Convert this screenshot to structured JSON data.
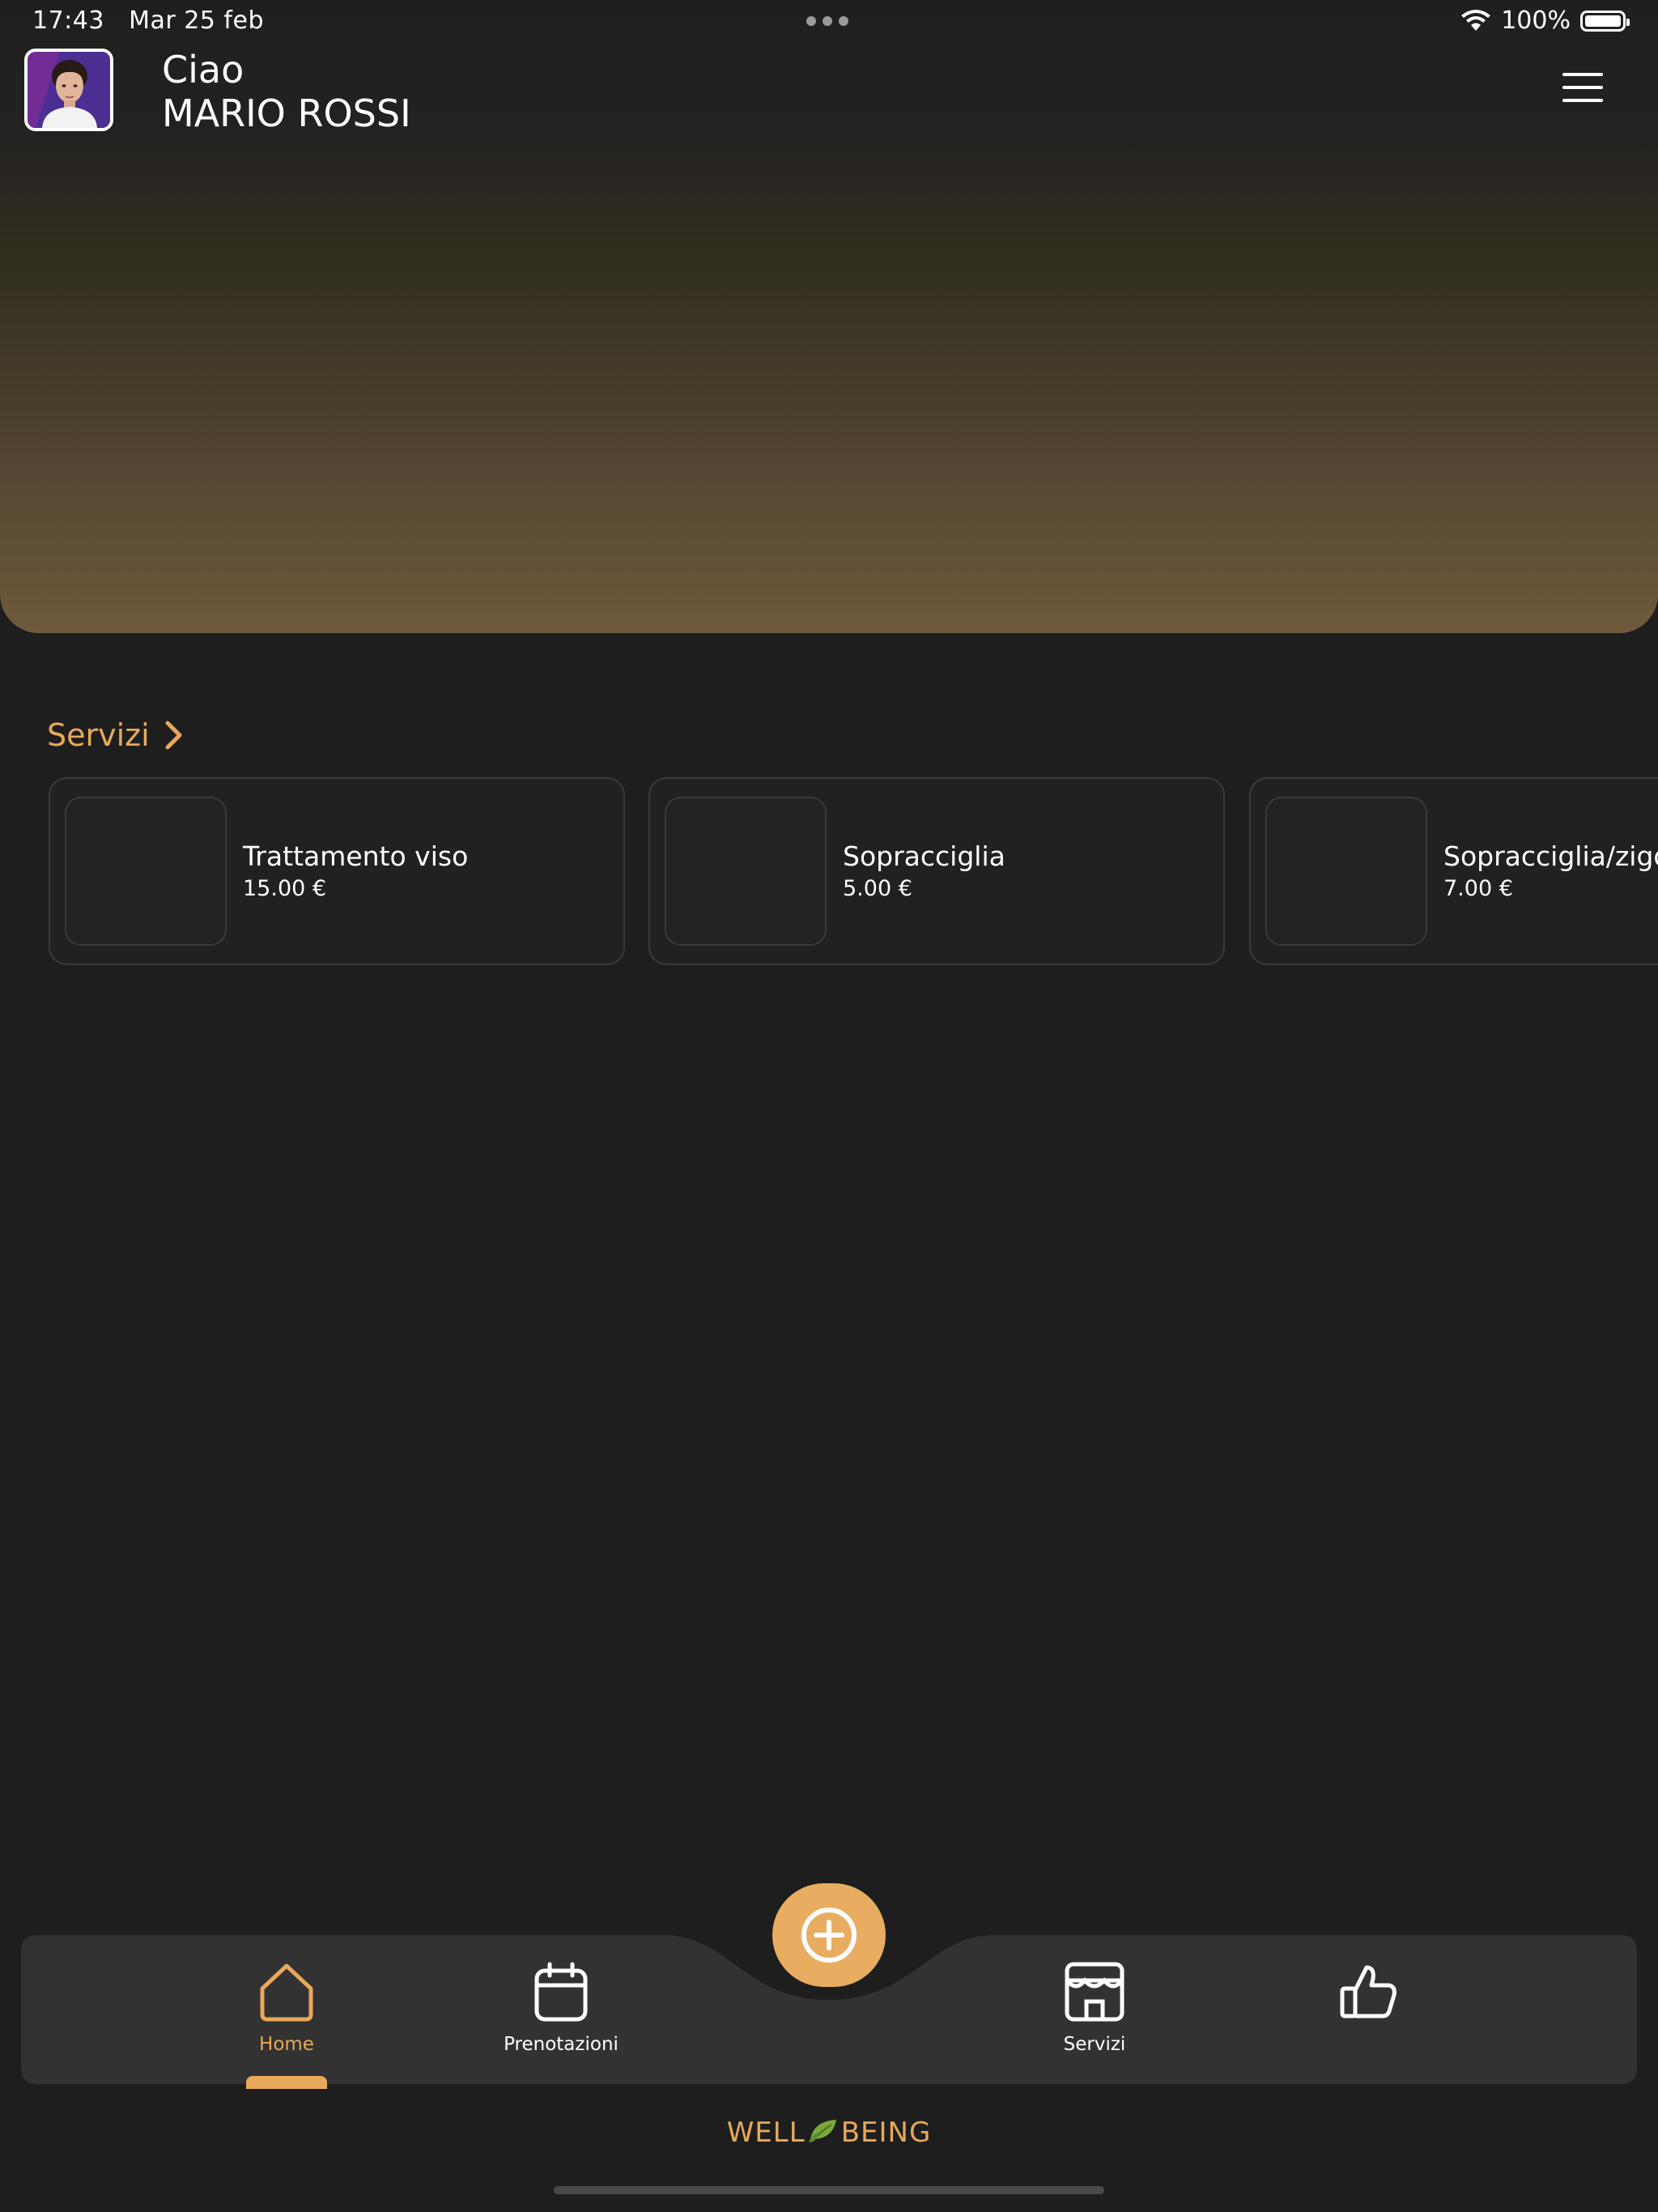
{
  "status_bar": {
    "time": "17:43",
    "date": "Mar 25 feb",
    "battery_text": "100%",
    "battery_level": 1.0
  },
  "header": {
    "greeting": "Ciao",
    "user_name": "MARIO ROSSI",
    "avatar_icon": "user-avatar",
    "menu_icon": "hamburger-menu-icon"
  },
  "services_section": {
    "title": "Servizi",
    "chevron_icon": "chevron-right-icon",
    "items": [
      {
        "name": "Trattamento viso",
        "price": "15.00 €"
      },
      {
        "name": "Sopracciglia",
        "price": "5.00 €"
      },
      {
        "name": "Sopracciglia/zigomi",
        "price": "7.00 €"
      }
    ]
  },
  "bottom_nav": {
    "items": [
      {
        "label": "Home",
        "icon": "home-icon",
        "active": true
      },
      {
        "label": "Prenotazioni",
        "icon": "calendar-icon",
        "active": false
      },
      {
        "label": "Servizi",
        "icon": "store-icon",
        "active": false
      },
      {
        "label": "",
        "icon": "thumbs-up-icon",
        "active": false
      }
    ],
    "fab_icon": "plus-circle-icon"
  },
  "footer": {
    "brand_left": "WELL",
    "brand_right": "BEING",
    "brand_icon": "leaf-icon"
  },
  "colors": {
    "accent": "#e8a95a",
    "background": "#1e1e1e",
    "nav_background": "#323232",
    "card_border": "#3a3a3a"
  }
}
